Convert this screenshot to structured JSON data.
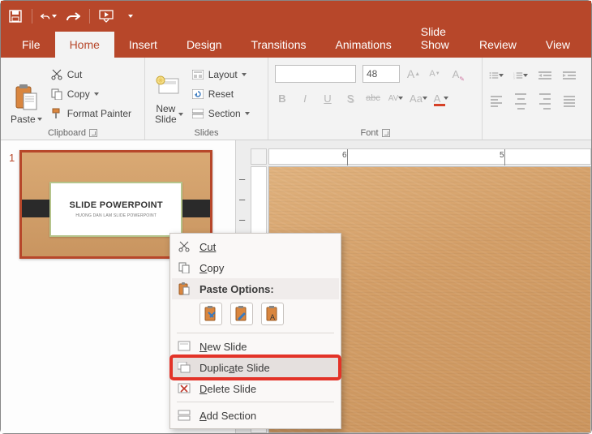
{
  "qat": {
    "save": "Save",
    "undo": "Undo",
    "redo": "Redo",
    "start": "Start From Beginning"
  },
  "tabs": {
    "file": "File",
    "home": "Home",
    "insert": "Insert",
    "design": "Design",
    "transitions": "Transitions",
    "animations": "Animations",
    "slideshow": "Slide Show",
    "review": "Review",
    "view": "View"
  },
  "ribbon": {
    "clipboard": {
      "label": "Clipboard",
      "paste": "Paste",
      "cut": "Cut",
      "copy": "Copy",
      "format_painter": "Format Painter"
    },
    "slides": {
      "label": "Slides",
      "new_slide": "New\nSlide",
      "layout": "Layout",
      "reset": "Reset",
      "section": "Section"
    },
    "font": {
      "label": "Font",
      "name_value": "",
      "size_value": "48",
      "bold": "B",
      "italic": "I",
      "underline": "U",
      "shadow": "S",
      "strike": "abc",
      "spacing": "AV",
      "case": "Aa",
      "font_color": "A",
      "grow": "A",
      "shrink": "A",
      "clear": "A"
    },
    "paragraph": {
      "label": ""
    }
  },
  "thumb": {
    "number": "1",
    "title": "SLIDE POWERPOINT",
    "subtitle": "HUONG DAN LAM SLIDE POWERPOINT"
  },
  "ruler": {
    "h_labels": [
      "6",
      "5"
    ]
  },
  "context_menu": {
    "cut": "Cut",
    "copy": "Copy",
    "paste_options": "Paste Options:",
    "new_slide": "New Slide",
    "duplicate_slide": "Duplicate Slide",
    "delete_slide": "Delete Slide",
    "add_section": "Add Section"
  },
  "colors": {
    "accent": "#b7472a",
    "highlight_border": "#e33328"
  }
}
